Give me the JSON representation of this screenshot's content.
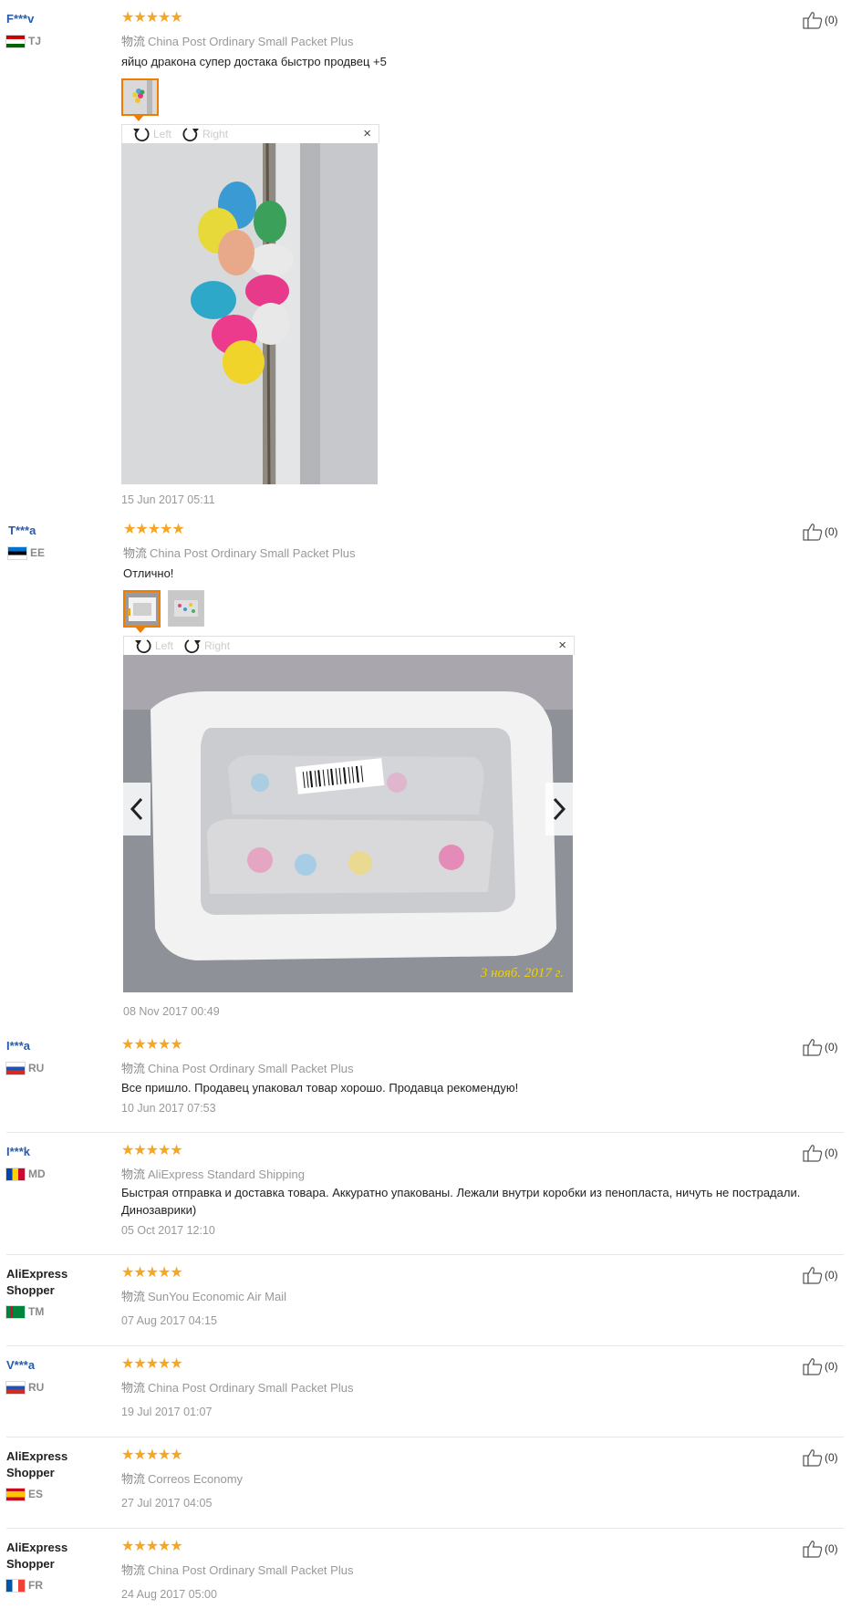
{
  "reviews": [
    {
      "name": "F***v",
      "country": "TJ",
      "flag": "tj",
      "rating": "★★★★★",
      "ship_label": "物流",
      "ship": "China Post Ordinary Small Packet Plus",
      "text": "яйцо дракона супер достака быстро продвец +5",
      "date": "15 Jun 2017 05:11",
      "helpful": "(0)",
      "viewer": {
        "left": "Left",
        "right": "Right",
        "close": "×"
      }
    },
    {
      "name": "T***a",
      "country": "EE",
      "flag": "ee",
      "rating": "★★★★★",
      "ship_label": "物流",
      "ship": "China Post Ordinary Small Packet Plus",
      "text": "Отлично!",
      "date": "08 Nov 2017 00:49",
      "helpful": "(0)",
      "viewer": {
        "left": "Left",
        "right": "Right",
        "close": "×"
      },
      "photo_stamp": "3 нояб. 2017 г."
    },
    {
      "name": "I***a",
      "country": "RU",
      "flag": "ru",
      "rating": "★★★★★",
      "ship_label": "物流",
      "ship": "China Post Ordinary Small Packet Plus",
      "text": "Все пришло. Продавец упаковал товар хорошо. Продавца рекомендую!",
      "date": "10 Jun 2017 07:53",
      "helpful": "(0)"
    },
    {
      "name": "I***k",
      "country": "MD",
      "flag": "md",
      "rating": "★★★★★",
      "ship_label": "物流",
      "ship": "AliExpress Standard Shipping",
      "text": "Быстрая отправка и доставка товара. Аккуратно упакованы. Лежали внутри коробки из пенопласта, ничуть не пострадали. Динозаврики)",
      "date": "05 Oct 2017 12:10",
      "helpful": "(0)"
    },
    {
      "name": "AliExpress Shopper",
      "country": "TM",
      "flag": "tm",
      "rating": "★★★★★",
      "ship_label": "物流",
      "ship": "SunYou Economic Air Mail",
      "date": "07 Aug 2017 04:15",
      "helpful": "(0)"
    },
    {
      "name": "V***a",
      "country": "RU",
      "flag": "ru",
      "rating": "★★★★★",
      "ship_label": "物流",
      "ship": "China Post Ordinary Small Packet Plus",
      "date": "19 Jul 2017 01:07",
      "helpful": "(0)"
    },
    {
      "name": "AliExpress Shopper",
      "country": "ES",
      "flag": "es",
      "rating": "★★★★★",
      "ship_label": "物流",
      "ship": "Correos Economy",
      "date": "27 Jul 2017 04:05",
      "helpful": "(0)"
    },
    {
      "name": "AliExpress Shopper",
      "country": "FR",
      "flag": "fr",
      "rating": "★★★★★",
      "ship_label": "物流",
      "ship": "China Post Ordinary Small Packet Plus",
      "date": "24 Aug 2017 05:00",
      "helpful": "(0)"
    }
  ]
}
